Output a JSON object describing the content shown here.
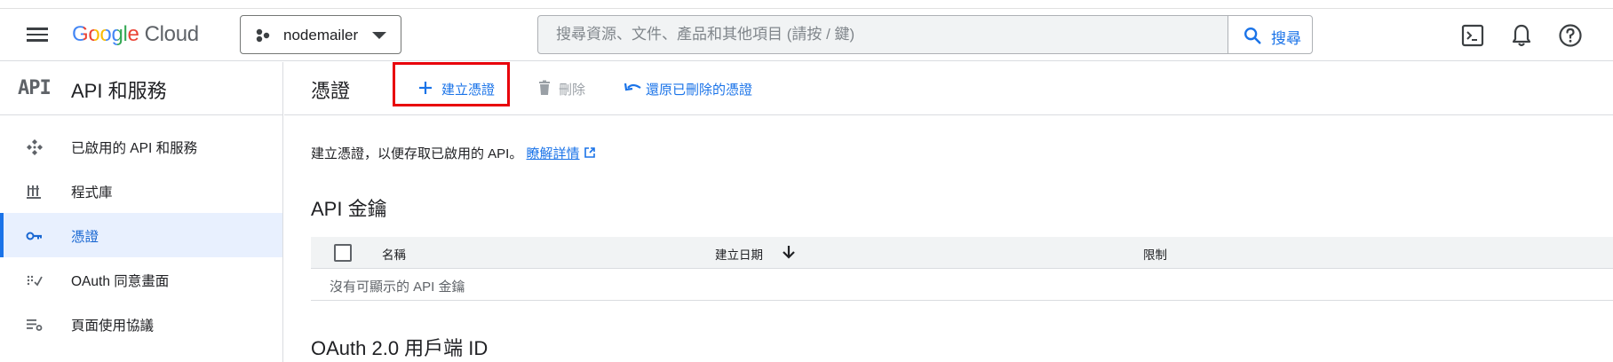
{
  "header": {
    "logo_google": "Google",
    "logo_cloud": "Cloud",
    "project_name": "nodemailer",
    "search_placeholder": "搜尋資源、文件、產品和其他項目 (請按 / 鍵)",
    "search_button": "搜尋",
    "icons": [
      "menu-icon",
      "terminal-icon",
      "notifications-icon",
      "help-icon"
    ]
  },
  "sidebar": {
    "badge": "API",
    "title": "API 和服務",
    "items": [
      {
        "label": "已啟用的 API 和服務",
        "icon": "enabled-apis-icon"
      },
      {
        "label": "程式庫",
        "icon": "library-icon"
      },
      {
        "label": "憑證",
        "icon": "key-icon",
        "active": true
      },
      {
        "label": "OAuth 同意畫面",
        "icon": "oauth-consent-icon"
      },
      {
        "label": "頁面使用協議",
        "icon": "page-agreement-icon"
      }
    ]
  },
  "main": {
    "title": "憑證",
    "toolbar": {
      "create": "建立憑證",
      "delete": "刪除",
      "restore": "還原已刪除的憑證"
    },
    "description": "建立憑證，以便存取已啟用的 API。",
    "learn_more": "瞭解詳情",
    "api_keys": {
      "title": "API 金鑰",
      "columns": [
        "名稱",
        "建立日期",
        "限制"
      ],
      "empty_text": "沒有可顯示的 API 金鑰"
    },
    "oauth_title": "OAuth 2.0 用戶端 ID"
  },
  "colors": {
    "accent": "#1a73e8",
    "highlight_box": "#e8000b",
    "active_bg": "#e8f0fe"
  }
}
